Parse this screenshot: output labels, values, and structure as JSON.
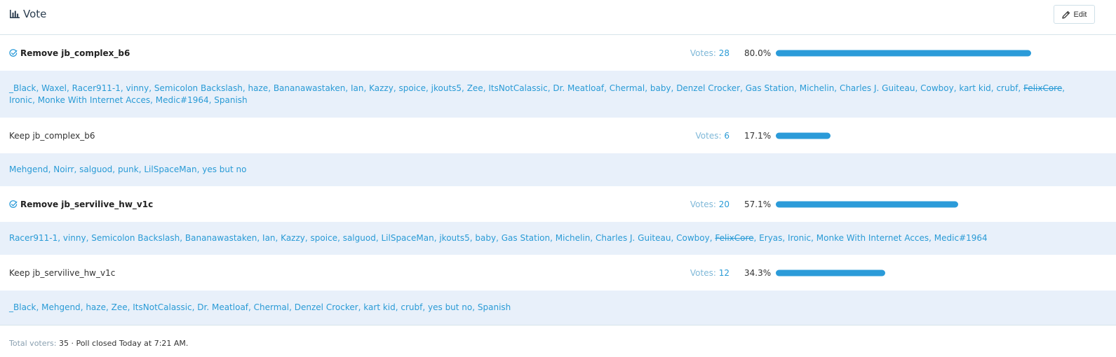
{
  "header": {
    "title": "Vote",
    "edit_label": "Edit"
  },
  "poll": {
    "votes_label": "Votes:",
    "options": [
      {
        "label": "Remove jb_complex_b6",
        "winner": true,
        "votes": "28",
        "percent_text": "80.0%",
        "fill_fraction": 0.8,
        "voters": [
          "_Black",
          "Waxel",
          "Racer911-1",
          "vinny",
          "Semicolon Backslash",
          "haze",
          "Bananawastaken",
          "Ian",
          "Kazzy",
          "spoice",
          "jkouts5",
          "Zee",
          "ItsNotCalassic",
          "Dr. Meatloaf",
          "Chermal",
          "baby",
          "Denzel Crocker",
          "Gas Station",
          "Michelin",
          "Charles J. Guiteau",
          "Cowboy",
          "kart kid",
          "crubf",
          "FelixCore",
          "Ironic",
          "Monke With Internet Acces",
          "Medic#1964",
          "Spanish"
        ],
        "struck_voters": [
          "FelixCore"
        ]
      },
      {
        "label": "Keep jb_complex_b6",
        "winner": false,
        "votes": "6",
        "percent_text": "17.1%",
        "fill_fraction": 0.171,
        "voters": [
          "Mehgend",
          "Noirr",
          "salguod",
          "punk",
          "LilSpaceMan",
          "yes but no"
        ],
        "struck_voters": []
      },
      {
        "label": "Remove jb_servilive_hw_v1c",
        "winner": true,
        "votes": "20",
        "percent_text": "57.1%",
        "fill_fraction": 0.571,
        "voters": [
          "Racer911-1",
          "vinny",
          "Semicolon Backslash",
          "Bananawastaken",
          "Ian",
          "Kazzy",
          "spoice",
          "salguod",
          "LilSpaceMan",
          "jkouts5",
          "baby",
          "Gas Station",
          "Michelin",
          "Charles J. Guiteau",
          "Cowboy",
          "FelixCore",
          "Eryas",
          "Ironic",
          "Monke With Internet Acces",
          "Medic#1964"
        ],
        "struck_voters": [
          "FelixCore"
        ]
      },
      {
        "label": "Keep jb_servilive_hw_v1c",
        "winner": false,
        "votes": "12",
        "percent_text": "34.3%",
        "fill_fraction": 0.343,
        "voters": [
          "_Black",
          "Mehgend",
          "haze",
          "Zee",
          "ItsNotCalassic",
          "Dr. Meatloaf",
          "Chermal",
          "Denzel Crocker",
          "kart kid",
          "crubf",
          "yes but no",
          "Spanish"
        ],
        "struck_voters": []
      }
    ]
  },
  "footer": {
    "total_label": "Total voters:",
    "total_value": "35",
    "status_text": " · Poll closed Today at 7:21 AM."
  },
  "colors": {
    "accent": "#2b9bd9",
    "voter_bg": "#e8f0fa",
    "link": "#2a9bd6"
  },
  "icons": {
    "title": "bar-chart-icon",
    "edit": "pencil-icon",
    "winner": "check-circle-icon"
  }
}
